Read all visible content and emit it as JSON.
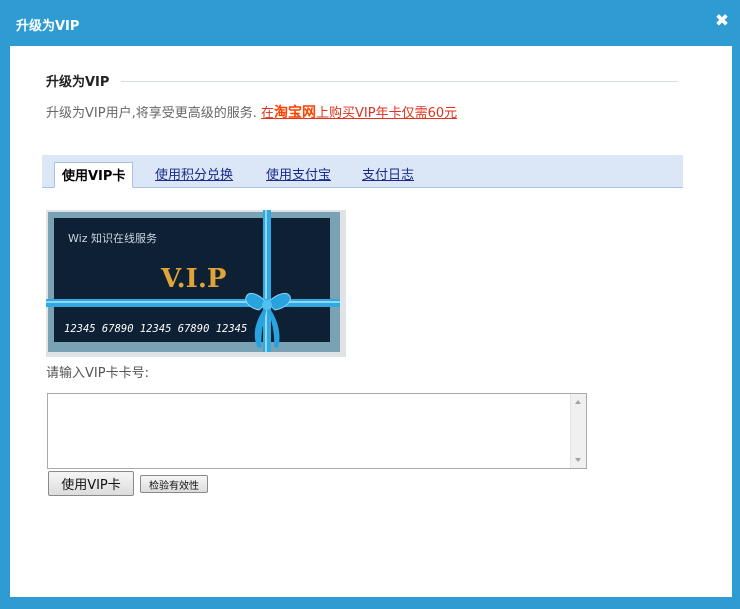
{
  "window": {
    "title": "升级为VIP",
    "close_icon": "close-icon",
    "accent_color": "#2e9bd3"
  },
  "section": {
    "heading": "升级为VIP"
  },
  "promo": {
    "text": "升级为VIP用户,将享受更高级的服务.",
    "link_prefix": "在",
    "link_brand": "淘宝网",
    "link_suffix": "上购买VIP年卡仅需60元"
  },
  "tabs": [
    {
      "label": "使用VIP卡",
      "active": true
    },
    {
      "label": "使用积分兑换",
      "active": false
    },
    {
      "label": "使用支付宝",
      "active": false
    },
    {
      "label": "支付日志",
      "active": false
    }
  ],
  "card": {
    "service_text": "Wiz 知识在线服务",
    "vip_text": "V.I.P",
    "card_number": "12345 67890 12345 67890 12345"
  },
  "form": {
    "prompt": "请输入VIP卡卡号:",
    "input_value": "",
    "submit_label": "使用VIP卡",
    "check_label": "检验有效性"
  }
}
